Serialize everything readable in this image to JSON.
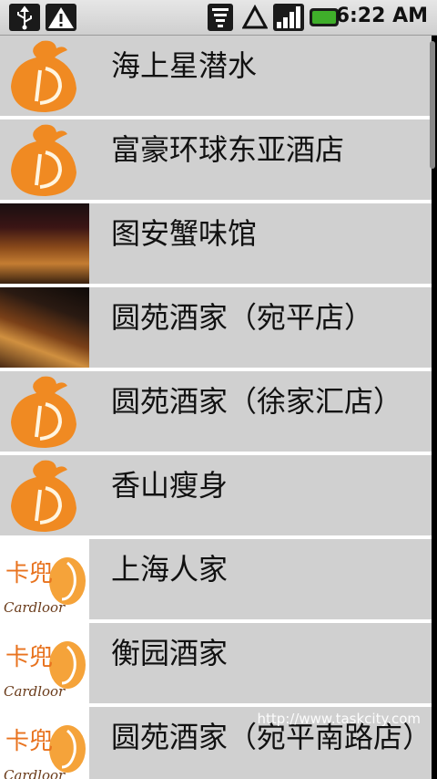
{
  "status_bar": {
    "time": "6:22 AM",
    "icons": [
      "usb-icon",
      "warning-icon",
      "wifi-icon",
      "data-roaming-icon",
      "signal-icon",
      "battery-icon"
    ],
    "battery_color": "#3fae2a"
  },
  "list": {
    "items": [
      {
        "title": "海上星潜水",
        "thumb": "d-logo"
      },
      {
        "title": "富豪环球东亚酒店",
        "thumb": "d-logo"
      },
      {
        "title": "图安蟹味馆",
        "thumb": "photo"
      },
      {
        "title": "圆苑酒家（宛平店）",
        "thumb": "photo"
      },
      {
        "title": "圆苑酒家（徐家汇店）",
        "thumb": "d-logo"
      },
      {
        "title": "香山瘦身",
        "thumb": "d-logo"
      },
      {
        "title": "上海人家",
        "thumb": "cardloor-logo"
      },
      {
        "title": "衡园酒家",
        "thumb": "cardloor-logo"
      },
      {
        "title": "圆苑酒家（宛平南路店）",
        "thumb": "cardloor-logo"
      }
    ]
  },
  "watermark": "http://www.taskcity.com",
  "colors": {
    "row_bg": "#d0d0d0",
    "divider": "#ffffff",
    "logo_orange": "#f08a22"
  }
}
